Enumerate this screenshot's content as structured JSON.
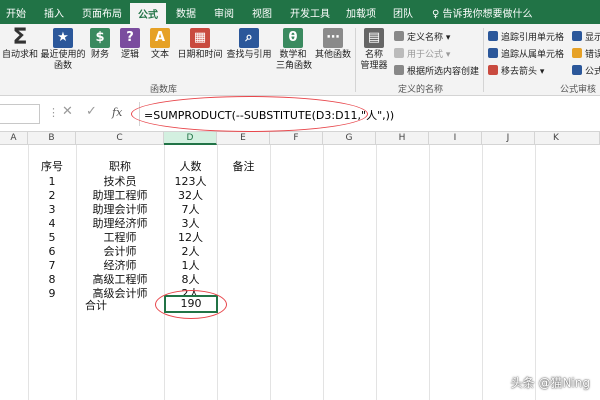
{
  "tabs": [
    "开始",
    "插入",
    "页面布局",
    "公式",
    "数据",
    "审阅",
    "视图",
    "开发工具",
    "加载项",
    "团队"
  ],
  "active_tab": "公式",
  "tellme": "告诉我你想要做什么",
  "ribbon": {
    "autosum": "自动求和",
    "recent": "最近使用的",
    "recent2": "函数",
    "finance": "财务",
    "logic": "逻辑",
    "text": "文本",
    "datetime": "日期和时间",
    "lookup": "查找与引用",
    "math": "数学和",
    "math2": "三角函数",
    "more": "其他函数",
    "group_lib": "函数库",
    "name_mgr": "名称",
    "name_mgr2": "管理器",
    "define_name": "定义名称",
    "use_in_formula": "用于公式",
    "create_from_sel": "根据所选内容创建",
    "group_names": "定义的名称",
    "trace_prec": "追踪引用单元格",
    "trace_dep": "追踪从属单元格",
    "remove_arrows": "移去箭头",
    "show": "显示",
    "errcheck": "错误",
    "eval": "公式",
    "group_audit": "公式审核"
  },
  "formula": "=SUMPRODUCT(--SUBSTITUTE(D3:D11,\"人\",))",
  "columns": [
    "A",
    "B",
    "C",
    "D",
    "E",
    "F",
    "G",
    "H",
    "I",
    "J",
    "K"
  ],
  "headers": {
    "no": "序号",
    "title": "职称",
    "count": "人数",
    "note": "备注"
  },
  "rows": [
    {
      "no": "1",
      "title": "技术员",
      "count": "123人"
    },
    {
      "no": "2",
      "title": "助理工程师",
      "count": "32人"
    },
    {
      "no": "3",
      "title": "助理会计师",
      "count": "7人"
    },
    {
      "no": "4",
      "title": "助理经济师",
      "count": "3人"
    },
    {
      "no": "5",
      "title": "工程师",
      "count": "12人"
    },
    {
      "no": "6",
      "title": "会计师",
      "count": "2人"
    },
    {
      "no": "7",
      "title": "经济师",
      "count": "1人"
    },
    {
      "no": "8",
      "title": "高级工程师",
      "count": "8人"
    },
    {
      "no": "9",
      "title": "高级会计师",
      "count": "2人"
    }
  ],
  "total_label": "合计",
  "total_value": "190",
  "watermark": "头条 @猫Ning",
  "colors": {
    "accent": "#217346",
    "annotation": "#e8474c"
  }
}
